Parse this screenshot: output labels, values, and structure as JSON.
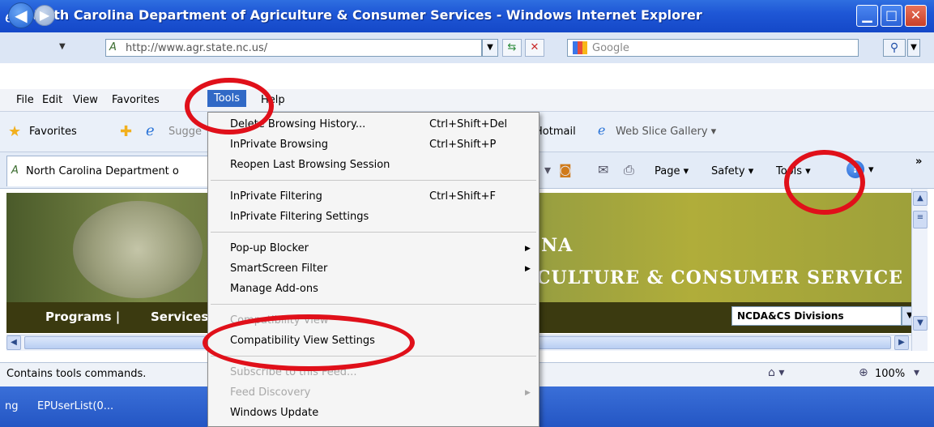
{
  "window": {
    "title": "North Carolina Department of Agriculture & Consumer Services - Windows Internet Explorer",
    "min_glyph": "▁",
    "max_glyph": "□",
    "close_glyph": "✕"
  },
  "address": {
    "url": "http://www.agr.state.nc.us/",
    "search_placeholder": "Google"
  },
  "menubar": [
    "File",
    "Edit",
    "View",
    "Favorites",
    "Tools",
    "Help"
  ],
  "favorites": {
    "label": "Favorites",
    "suggested": "Sugge",
    "hotmail": "Hotmail",
    "web_slice": "Web Slice Gallery ▾"
  },
  "tab": {
    "title": "North Carolina Department o"
  },
  "command_bar": {
    "page": "Page ▾",
    "safety": "Safety ▾",
    "tools": "Tools ▾",
    "more": "»"
  },
  "page_content": {
    "banner_line1": "NA",
    "banner_line2": "CULTURE & CONSUMER SERVICE",
    "nav_programs": "Programs   |",
    "nav_services": "Services",
    "divisions_select": "NCDA&CS Divisions"
  },
  "tools_menu": {
    "items": [
      {
        "label": "Delete Browsing History...",
        "shortcut": "Ctrl+Shift+Del"
      },
      {
        "label": "InPrivate Browsing",
        "shortcut": "Ctrl+Shift+P"
      },
      {
        "label": "Reopen Last Browsing Session",
        "shortcut": ""
      },
      {
        "label": "InPrivate Filtering",
        "shortcut": "Ctrl+Shift+F"
      },
      {
        "label": "InPrivate Filtering Settings",
        "shortcut": ""
      },
      {
        "label": "Pop-up Blocker",
        "shortcut": ""
      },
      {
        "label": "SmartScreen Filter",
        "shortcut": ""
      },
      {
        "label": "Manage Add-ons",
        "shortcut": ""
      },
      {
        "label": "Compatibility View",
        "shortcut": ""
      },
      {
        "label": "Compatibility View Settings",
        "shortcut": ""
      },
      {
        "label": "Subscribe to this Feed...",
        "shortcut": ""
      },
      {
        "label": "Feed Discovery",
        "shortcut": ""
      },
      {
        "label": "Windows Update",
        "shortcut": ""
      }
    ]
  },
  "status": {
    "text": "Contains tools commands.",
    "zoom": "100%"
  },
  "taskbar": {
    "left_fragment": "ng",
    "item": "EPUserList(0..."
  },
  "colors": {
    "annotation": "#e0101a",
    "menu_highlight": "#3169c6"
  }
}
